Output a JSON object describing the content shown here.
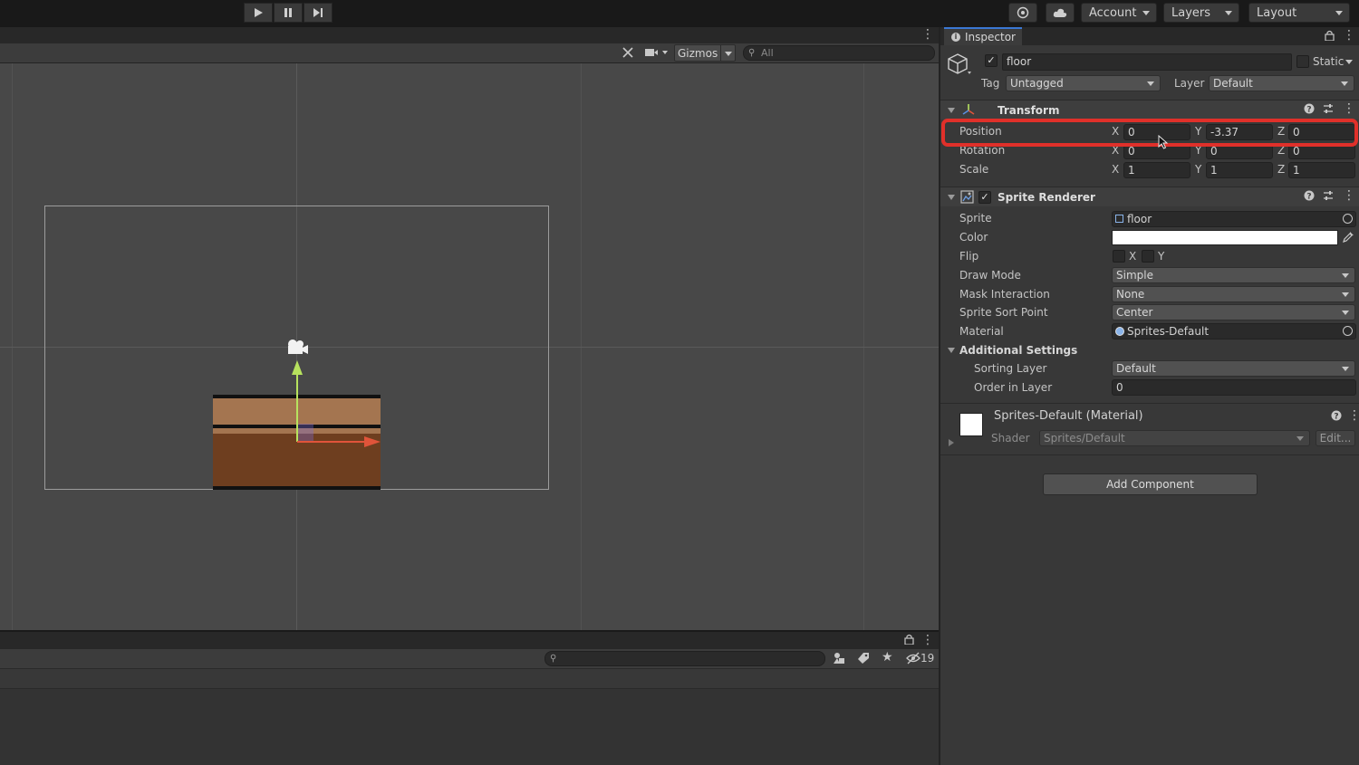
{
  "toolbar": {
    "account_label": "Account",
    "layers_label": "Layers",
    "layout_label": "Layout"
  },
  "scene": {
    "gizmos_label": "Gizmos",
    "search_placeholder": "All"
  },
  "project": {
    "hidden_count": "19"
  },
  "inspector": {
    "tab_label": "Inspector",
    "object_name": "floor",
    "static_label": "Static",
    "tag_label": "Tag",
    "tag_value": "Untagged",
    "layer_label": "Layer",
    "layer_value": "Default",
    "transform": {
      "title": "Transform",
      "position": {
        "label": "Position",
        "x": "0",
        "y": "-3.37",
        "z": "0"
      },
      "rotation": {
        "label": "Rotation",
        "x": "0",
        "y": "0",
        "z": "0"
      },
      "scale": {
        "label": "Scale",
        "x": "1",
        "y": "1",
        "z": "1"
      }
    },
    "sprite_renderer": {
      "title": "Sprite Renderer",
      "sprite_label": "Sprite",
      "sprite_value": "floor",
      "color_label": "Color",
      "flip_label": "Flip",
      "flip_x": "X",
      "flip_y": "Y",
      "draw_mode_label": "Draw Mode",
      "draw_mode_value": "Simple",
      "mask_label": "Mask Interaction",
      "mask_value": "None",
      "sort_point_label": "Sprite Sort Point",
      "sort_point_value": "Center",
      "material_label": "Material",
      "material_value": "Sprites-Default",
      "additional_label": "Additional Settings",
      "sorting_layer_label": "Sorting Layer",
      "sorting_layer_value": "Default",
      "order_label": "Order in Layer",
      "order_value": "0"
    },
    "material": {
      "title": "Sprites-Default (Material)",
      "shader_label": "Shader",
      "shader_value": "Sprites/Default",
      "edit_label": "Edit..."
    },
    "add_component_label": "Add Component"
  },
  "axis_labels": {
    "x": "X",
    "y": "Y",
    "z": "Z"
  },
  "colors": {
    "highlight": "#e0302a",
    "selection_tab": "#3a78d4",
    "floor_light": "#a47550",
    "floor_dark": "#6e3e1f",
    "gizmo_y": "#b7e25e",
    "gizmo_x": "#e0543a"
  }
}
